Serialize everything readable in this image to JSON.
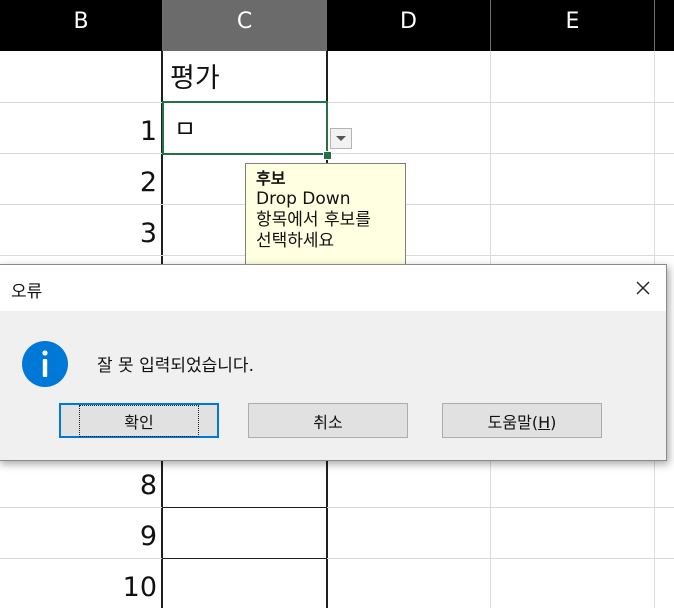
{
  "sheet": {
    "columns": [
      "B",
      "C",
      "D",
      "E"
    ],
    "selected_column": "C",
    "header_cell": "평가",
    "active_cell_value": "ㅁ",
    "row_labels": [
      "1",
      "2",
      "3",
      "8",
      "9",
      "10"
    ]
  },
  "tooltip": {
    "title": "후보",
    "line1": "Drop Down",
    "line2": "항목에서 후보를",
    "line3": "선택하세요"
  },
  "dialog": {
    "title": "오류",
    "message": "잘 못 입력되었습니다.",
    "ok_label": "확인",
    "cancel_label": "취소",
    "help_label_prefix": "도움말(",
    "help_label_hotkey": "H",
    "help_label_suffix": ")",
    "info_icon": "info-icon",
    "close_icon": "close-icon"
  },
  "colors": {
    "header_bg": "#000000",
    "selected_header_bg": "#6b6b6b",
    "selection_border": "#217346",
    "tooltip_bg": "#ffffe1",
    "info_icon_blue": "#0078d7",
    "dialog_body_bg": "#f0f0f0"
  }
}
